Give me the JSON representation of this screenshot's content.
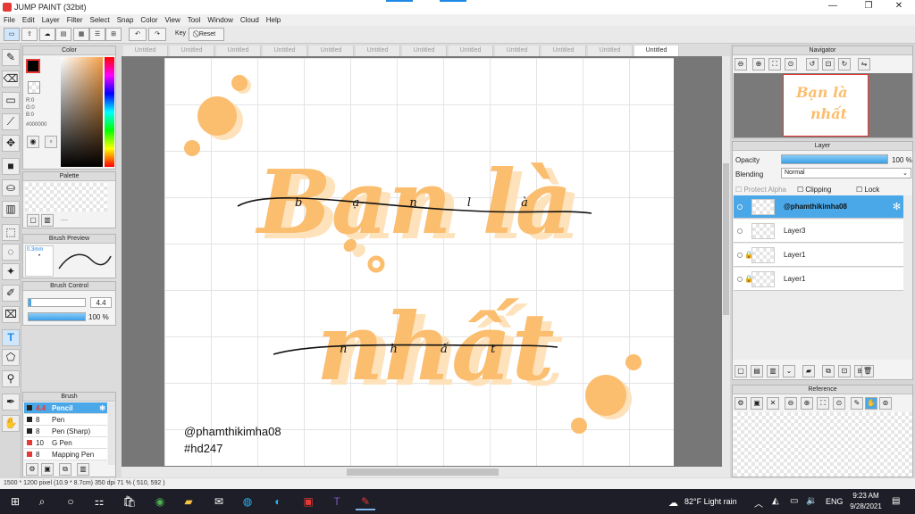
{
  "app": {
    "title": "JUMP PAINT (32bit)"
  },
  "menu": [
    "File",
    "Edit",
    "Layer",
    "Filter",
    "Select",
    "Snap",
    "Color",
    "View",
    "Tool",
    "Window",
    "Cloud",
    "Help"
  ],
  "toolbar": {
    "key_label": "Key",
    "reset_label": "Reset"
  },
  "tabs": [
    "Untitled",
    "Untitled",
    "Untitled",
    "Untitled",
    "Untitled",
    "Untitled",
    "Untitled",
    "Untitled",
    "Untitled",
    "Untitled",
    "Untitled",
    "Untitled"
  ],
  "color_panel": {
    "title": "Color",
    "r": "R:0",
    "g": "G:0",
    "b": "B:0",
    "hex": "#000000"
  },
  "palette_panel": {
    "title": "Palette",
    "dash": "----"
  },
  "brush_preview": {
    "title": "Brush Preview",
    "size": "0.3mm",
    "dot": "•"
  },
  "brush_control": {
    "title": "Brush Control",
    "size_value": "4.4",
    "opacity_value": "100 %"
  },
  "brush_list": {
    "title": "Brush",
    "items": [
      {
        "size": "4.4",
        "name": "Pencil",
        "color": "#222222"
      },
      {
        "size": "8",
        "name": "Pen",
        "color": "#222222"
      },
      {
        "size": "8",
        "name": "Pen (Sharp)",
        "color": "#222222"
      },
      {
        "size": "10",
        "name": "G Pen",
        "color": "#e53935"
      },
      {
        "size": "8",
        "name": "Mapping Pen",
        "color": "#e53935"
      }
    ]
  },
  "navigator": {
    "title": "Navigator",
    "thumb_line1": "Bạn là",
    "thumb_line2": "nhất"
  },
  "layer_panel": {
    "title": "Layer",
    "opacity_label": "Opacity",
    "opacity_value": "100 %",
    "blending_label": "Blending",
    "blending_value": "Normal",
    "protect_alpha": "Protect Alpha",
    "clipping": "Clipping",
    "lock": "Lock",
    "layers": [
      "@phamthikimha08",
      "Layer3",
      "Layer1",
      "Layer1"
    ]
  },
  "reference": {
    "title": "Reference"
  },
  "artwork": {
    "line1": "Bạn là",
    "line2": "nhất",
    "script1": "b ạ n l à",
    "script2": "n h ấ t",
    "credit": "@phamthikimha08",
    "tag": "#hd247",
    "ink": "#fbbd6e",
    "shadow": "#fde2bc"
  },
  "status": {
    "text": "1500 * 1200 pixel  (10.9 * 8.7cm)  350 dpi  71 %  ( 510, 592 )"
  },
  "taskbar": {
    "weather": "82°F  Light rain",
    "lang": "ENG",
    "time": "9:23 AM",
    "date": "9/28/2021"
  }
}
